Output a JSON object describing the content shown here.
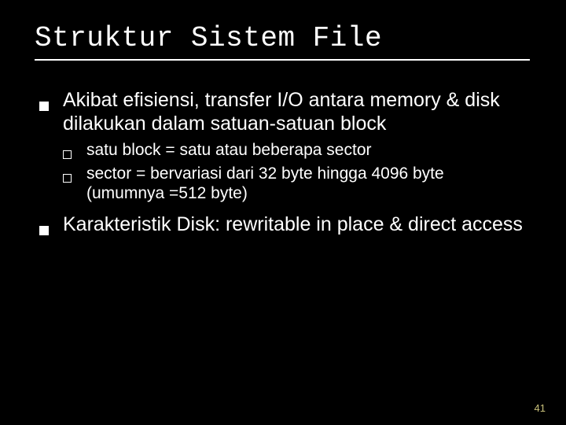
{
  "title": "Struktur Sistem File",
  "bullets": {
    "item1": "Akibat efisiensi, transfer I/O antara memory & disk dilakukan dalam satuan-satuan block",
    "item1_sub1": "satu block = satu atau beberapa sector",
    "item1_sub2": "sector = bervariasi dari 32 byte hingga 4096 byte (umumnya =512 byte)",
    "item2": "Karakteristik Disk: rewritable in place & direct access"
  },
  "page_number": "41"
}
